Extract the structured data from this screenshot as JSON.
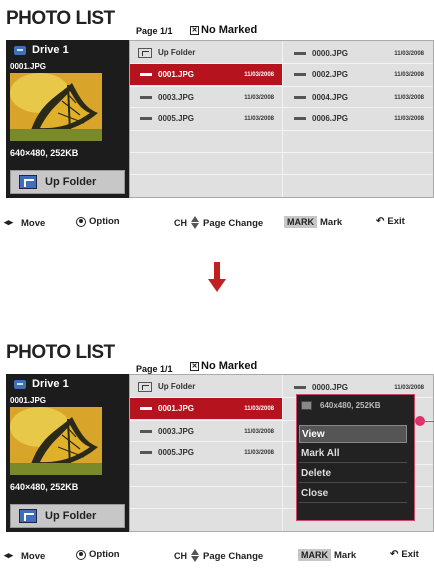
{
  "title": "PHOTO LIST",
  "page_info": "Page 1/1",
  "no_marked": "No Marked",
  "drive": "Drive 1",
  "selected_file": "0001.JPG",
  "resolution": "640×480, 252KB",
  "up_folder": "Up Folder",
  "files": [
    {
      "name": "0001.JPG",
      "date": "11/03/2008",
      "selected": true
    },
    {
      "name": "0002.JPG",
      "date": "11/03/2008"
    },
    {
      "name": "0003.JPG",
      "date": "11/03/2008"
    },
    {
      "name": "0004.JPG",
      "date": "11/03/2008"
    },
    {
      "name": "0005.JPG",
      "date": "11/03/2008"
    },
    {
      "name": "0006.JPG",
      "date": "11/03/2008"
    },
    {
      "name": "0000.JPG",
      "date": "11/03/2008"
    }
  ],
  "footer": {
    "move": "Move",
    "option": "Option",
    "ch": "CH",
    "page_change": "Page Change",
    "mark_key": "MARK",
    "mark": "Mark",
    "exit": "Exit"
  },
  "popup": {
    "info": "640x480, 252KB",
    "items": [
      "View",
      "Mark All",
      "Delete",
      "Close"
    ]
  }
}
